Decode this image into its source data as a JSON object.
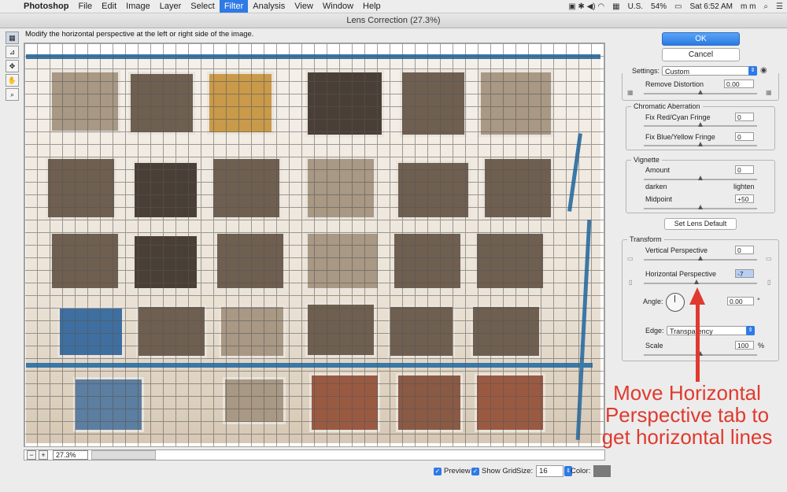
{
  "menubar": {
    "app": "Photoshop",
    "items": [
      "File",
      "Edit",
      "Image",
      "Layer",
      "Select",
      "Filter",
      "Analysis",
      "View",
      "Window",
      "Help"
    ],
    "active": "Filter",
    "status": {
      "locale": "U.S.",
      "battery": "54%",
      "clock": "Sat 6:52 AM",
      "user": "m m"
    }
  },
  "window": {
    "title": "Lens Correction (27.3%)"
  },
  "instruction": "Modify the horizontal perspective at the left or right side of the image.",
  "status_bar": {
    "zoom_out": "−",
    "zoom_in": "+",
    "zoom": "27.3%"
  },
  "bottom": {
    "preview_label": "Preview",
    "show_grid_label": "Show Grid",
    "size_label": "Size:",
    "size_value": "16",
    "color_label": "Color:"
  },
  "buttons": {
    "ok": "OK",
    "cancel": "Cancel",
    "set_lens_default": "Set Lens Default"
  },
  "settings": {
    "label": "Settings:",
    "value": "Custom"
  },
  "remove_distortion": {
    "label": "Remove Distortion",
    "value": "0.00",
    "fraction": 0.5
  },
  "chromatic": {
    "title": "Chromatic Aberration",
    "red_cyan": {
      "label": "Fix Red/Cyan Fringe",
      "value": "0",
      "fraction": 0.5
    },
    "blue_yellow": {
      "label": "Fix Blue/Yellow Fringe",
      "value": "0",
      "fraction": 0.5
    }
  },
  "vignette": {
    "title": "Vignette",
    "amount": {
      "label": "Amount",
      "value": "0",
      "fraction": 0.5
    },
    "darken": "darken",
    "lighten": "lighten",
    "midpoint": {
      "label": "Midpoint",
      "value": "+50",
      "fraction": 0.5
    }
  },
  "transform": {
    "title": "Transform",
    "vertical": {
      "label": "Vertical Perspective",
      "value": "0",
      "fraction": 0.5
    },
    "horizontal": {
      "label": "Horizontal Perspective",
      "value": "-7",
      "fraction": 0.465
    },
    "angle": {
      "label": "Angle:",
      "value": "0.00",
      "unit": "°"
    },
    "edge": {
      "label": "Edge:",
      "value": "Transparency"
    },
    "scale": {
      "label": "Scale",
      "value": "100",
      "unit": "%",
      "fraction": 0.5
    }
  },
  "annotation": "Move Horizontal Perspective tab to get horizontal lines",
  "colors": {
    "accent": "#2f7ae5",
    "annotation": "#e03a2e",
    "fence": "#3a78a8"
  }
}
